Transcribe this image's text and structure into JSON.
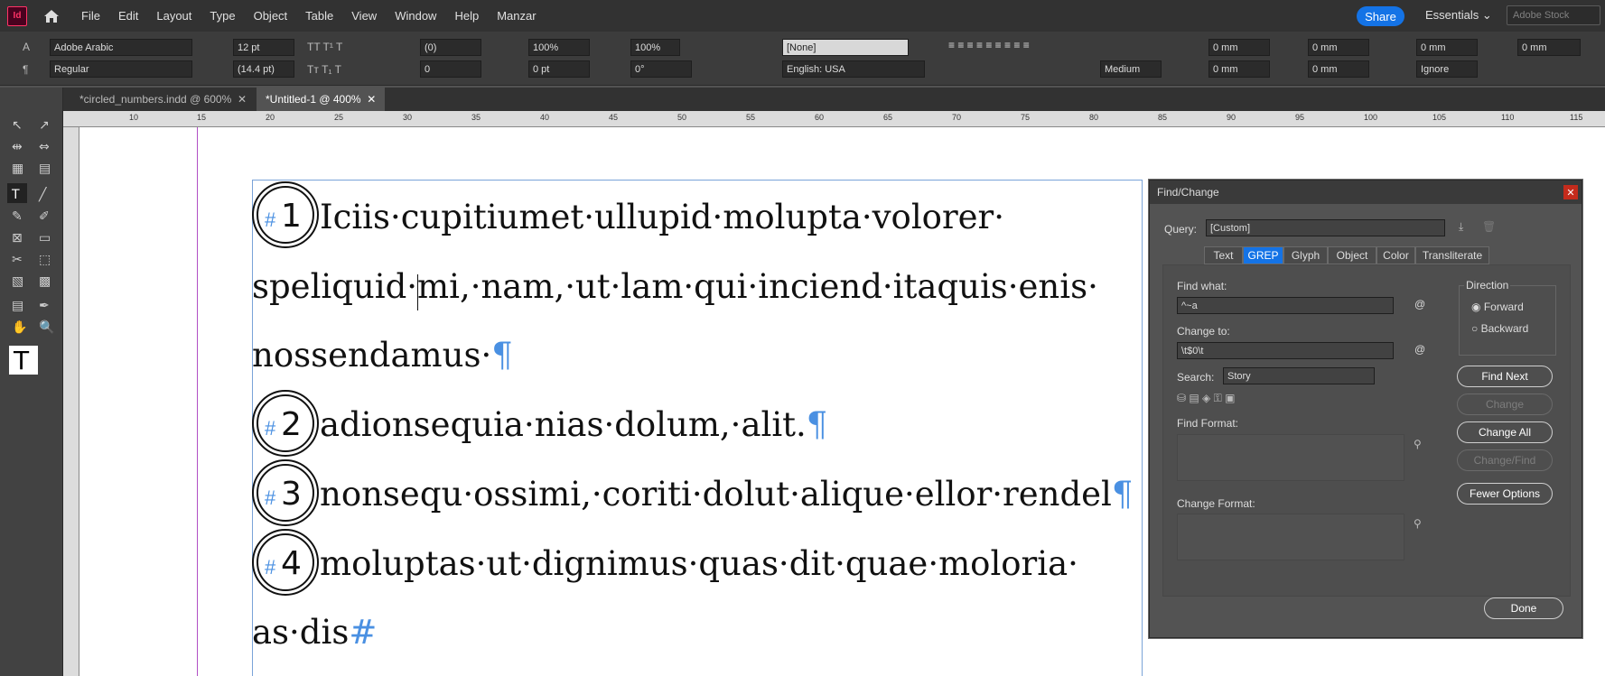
{
  "app": {
    "logo": "Id"
  },
  "menu": [
    "File",
    "Edit",
    "Layout",
    "Type",
    "Object",
    "Table",
    "View",
    "Window",
    "Help",
    "Manzar"
  ],
  "share_label": "Share",
  "workspace": "Essentials",
  "stock_placeholder": "Adobe Stock",
  "control": {
    "font": "Adobe Arabic",
    "style": "Regular",
    "size": "12 pt",
    "leading": "(14.4 pt)",
    "tracking": "(0)",
    "kerning": "0",
    "vscale": "100%",
    "hscale": "100%",
    "baseline": "0 pt",
    "skew": "0°",
    "char_style": "[None]",
    "language": "English: USA",
    "composer": "Medium",
    "indent_left": "0 mm",
    "indent_right": "0 mm",
    "first_line": "0 mm",
    "last_line": "0 mm",
    "space_before": "0 mm",
    "space_after": "0 mm",
    "grid": "Ignore"
  },
  "tabs": [
    "*circled_numbers.indd @ 600%",
    "*Untitled-1 @ 400%"
  ],
  "ruler_labels": [
    "10",
    "15",
    "20",
    "25",
    "30",
    "35",
    "40",
    "45",
    "50",
    "55",
    "60",
    "65",
    "70",
    "75",
    "80",
    "85",
    "90",
    "95",
    "100",
    "105",
    "110",
    "115"
  ],
  "document": {
    "circles": [
      "1",
      "2",
      "3",
      "4"
    ],
    "lines": [
      "Iciis·cupitiumet·ullupid·molupta·volorer·",
      "speliquid·mi,·nam,·ut·lam·qui·inciend·itaquis·enis·",
      "nossendamus·",
      "adionsequia·nias·dolum,·alit.",
      "nonsequ·ossimi,·coriti·dolut·alique·ellor·rendel",
      "moluptas·ut·dignimus·quas·dit·quae·moloria·",
      "as·dis"
    ],
    "pilcrow": "¶",
    "hash": "#"
  },
  "dialog": {
    "title": "Find/Change",
    "query_label": "Query:",
    "query_value": "[Custom]",
    "tabs": [
      "Text",
      "GREP",
      "Glyph",
      "Object",
      "Color",
      "Transliterate"
    ],
    "find_label": "Find what:",
    "find_value": "^~a",
    "change_label": "Change to:",
    "change_value": "\\t$0\\t",
    "search_label": "Search:",
    "search_value": "Story",
    "find_format": "Find Format:",
    "change_format": "Change Format:",
    "direction": "Direction",
    "forward": "Forward",
    "backward": "Backward",
    "buttons": [
      "Find Next",
      "Change",
      "Change All",
      "Change/Find",
      "Fewer Options"
    ],
    "done": "Done"
  }
}
